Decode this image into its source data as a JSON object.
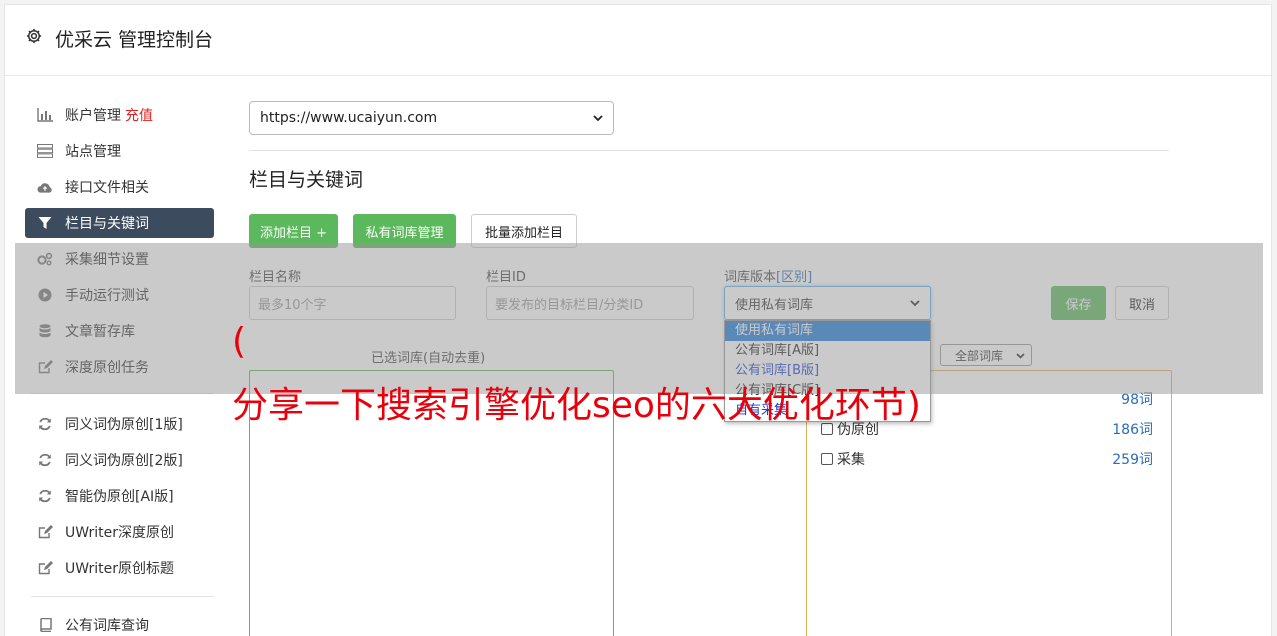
{
  "header": {
    "title": "优采云 管理控制台",
    "icon": "gear-icon"
  },
  "sidebar": {
    "items": [
      {
        "label": "账户管理",
        "extra": "充值",
        "icon": "bar-chart-icon"
      },
      {
        "label": "站点管理",
        "icon": "server-icon"
      },
      {
        "label": "接口文件相关",
        "icon": "cloud-upload-icon"
      },
      {
        "label": "栏目与关键词",
        "icon": "filter-icon"
      },
      {
        "label": "采集细节设置",
        "icon": "cogs-icon"
      },
      {
        "label": "手动运行测试",
        "icon": "play-circle-icon"
      },
      {
        "label": "文章暂存库",
        "icon": "database-icon"
      },
      {
        "label": "深度原创任务",
        "icon": "edit-icon"
      },
      {
        "label": "同义词伪原创[1版]",
        "icon": "refresh-icon"
      },
      {
        "label": "同义词伪原创[2版]",
        "icon": "refresh-icon"
      },
      {
        "label": "智能伪原创[AI版]",
        "icon": "refresh-icon"
      },
      {
        "label": "UWriter深度原创",
        "icon": "edit-icon"
      },
      {
        "label": "UWriter原创标题",
        "icon": "edit-icon"
      },
      {
        "label": "公有词库查询",
        "icon": "book-icon"
      }
    ]
  },
  "main": {
    "site_select": "https://www.ucaiyun.com",
    "section_title": "栏目与关键词",
    "buttons": {
      "add_column": "添加栏目 +",
      "private_lib": "私有词库管理",
      "batch_add": "批量添加栏目",
      "save": "保存",
      "cancel": "取消"
    },
    "form": {
      "name_label": "栏目名称",
      "name_placeholder": "最多10个字",
      "id_label": "栏目ID",
      "id_placeholder": "要发布的目标栏目/分类ID",
      "version_label": "词库版本",
      "version_diff": "[区别]",
      "version_value": "使用私有词库",
      "version_options": [
        "使用私有词库",
        "公有词库[A版]",
        "公有词库[B版]",
        "公有词库[C版]",
        "自有采集"
      ]
    },
    "selected_lib_title": "已选词库(自动去重)",
    "all_lib_filter": "全部词库",
    "libs": [
      {
        "name": "",
        "count": "98词"
      },
      {
        "name": "伪原创",
        "count": "186词"
      },
      {
        "name": "采集",
        "count": "259词"
      }
    ]
  },
  "overlay": {
    "line1": "(",
    "line2": "分享一下搜索引擎优化seo的六大优化环节)"
  },
  "colors": {
    "accent_green": "#5cb85c",
    "active_nav": "#3d4b5e",
    "recharge_red": "#e02020",
    "overlay_red": "#e8000b"
  }
}
